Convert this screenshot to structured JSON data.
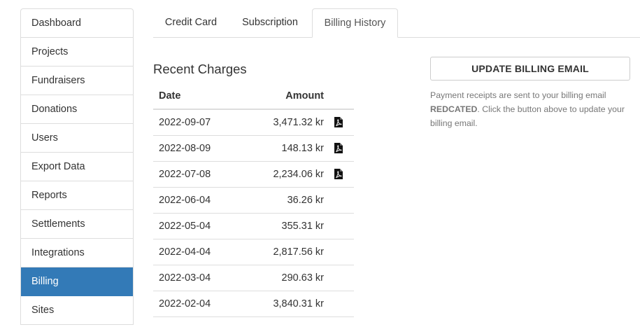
{
  "sidebar": {
    "items": [
      {
        "label": "Dashboard"
      },
      {
        "label": "Projects"
      },
      {
        "label": "Fundraisers"
      },
      {
        "label": "Donations"
      },
      {
        "label": "Users"
      },
      {
        "label": "Export Data"
      },
      {
        "label": "Reports"
      },
      {
        "label": "Settlements"
      },
      {
        "label": "Integrations"
      },
      {
        "label": "Billing"
      },
      {
        "label": "Sites"
      }
    ],
    "active": "Billing"
  },
  "tabs": [
    {
      "label": "Credit Card"
    },
    {
      "label": "Subscription"
    },
    {
      "label": "Billing History"
    }
  ],
  "active_tab": "Billing History",
  "charges": {
    "title": "Recent Charges",
    "columns": {
      "date": "Date",
      "amount": "Amount"
    },
    "rows": [
      {
        "date": "2022-09-07",
        "amount": "3,471.32 kr",
        "receipt": true
      },
      {
        "date": "2022-08-09",
        "amount": "148.13 kr",
        "receipt": true
      },
      {
        "date": "2022-07-08",
        "amount": "2,234.06 kr",
        "receipt": true
      },
      {
        "date": "2022-06-04",
        "amount": "36.26 kr",
        "receipt": false
      },
      {
        "date": "2022-05-04",
        "amount": "355.31 kr",
        "receipt": false
      },
      {
        "date": "2022-04-04",
        "amount": "2,817.56 kr",
        "receipt": false
      },
      {
        "date": "2022-03-04",
        "amount": "290.63 kr",
        "receipt": false
      },
      {
        "date": "2022-02-04",
        "amount": "3,840.31 kr",
        "receipt": false
      }
    ],
    "receipt_icon": "file-pdf-icon"
  },
  "billing_email": {
    "button_label": "UPDATE BILLING EMAIL",
    "note_before": "Payment receipts are sent to your billing email ",
    "email": "REDCATED",
    "note_after": ". Click the button above to update your billing email."
  },
  "colors": {
    "active_sidebar_bg": "#337ab7",
    "border": "#dddddd",
    "muted_text": "#777777"
  }
}
